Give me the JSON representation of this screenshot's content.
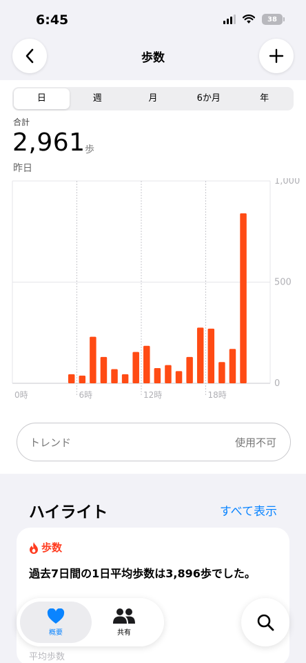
{
  "status": {
    "time": "6:45",
    "battery": "38"
  },
  "nav": {
    "title": "歩数"
  },
  "periods": [
    "日",
    "週",
    "月",
    "6か月",
    "年"
  ],
  "summary": {
    "label": "合計",
    "value": "2,961",
    "unit": "歩",
    "date": "昨日"
  },
  "chart_data": {
    "type": "bar",
    "categories": [
      "0時",
      "1時",
      "2時",
      "3時",
      "4時",
      "5時",
      "6時",
      "7時",
      "8時",
      "9時",
      "10時",
      "11時",
      "12時",
      "13時",
      "14時",
      "15時",
      "16時",
      "17時",
      "18時",
      "19時",
      "20時",
      "21時",
      "22時",
      "23時"
    ],
    "values": [
      0,
      0,
      0,
      0,
      0,
      45,
      38,
      230,
      130,
      70,
      45,
      155,
      185,
      75,
      90,
      60,
      130,
      275,
      270,
      105,
      170,
      840,
      0,
      0
    ],
    "x_tick_labels": [
      "0時",
      "6時",
      "12時",
      "18時"
    ],
    "y_tick_labels": [
      "1,000",
      "500",
      "0"
    ],
    "ylim": [
      0,
      1000
    ],
    "colors": {
      "bar": "#ff4b14"
    }
  },
  "trend": {
    "label": "トレンド",
    "value": "使用不可"
  },
  "highlights": {
    "title": "ハイライト",
    "show_all": "すべて表示",
    "card": {
      "tag": "歩数",
      "text": "過去7日間の1日平均歩数は3,896歩でした。"
    },
    "footer_hint": "平均歩数"
  },
  "tabs": {
    "summary": "概要",
    "sharing": "共有"
  },
  "colors": {
    "accent": "#0a84ff",
    "steps": "#ff4b14"
  }
}
